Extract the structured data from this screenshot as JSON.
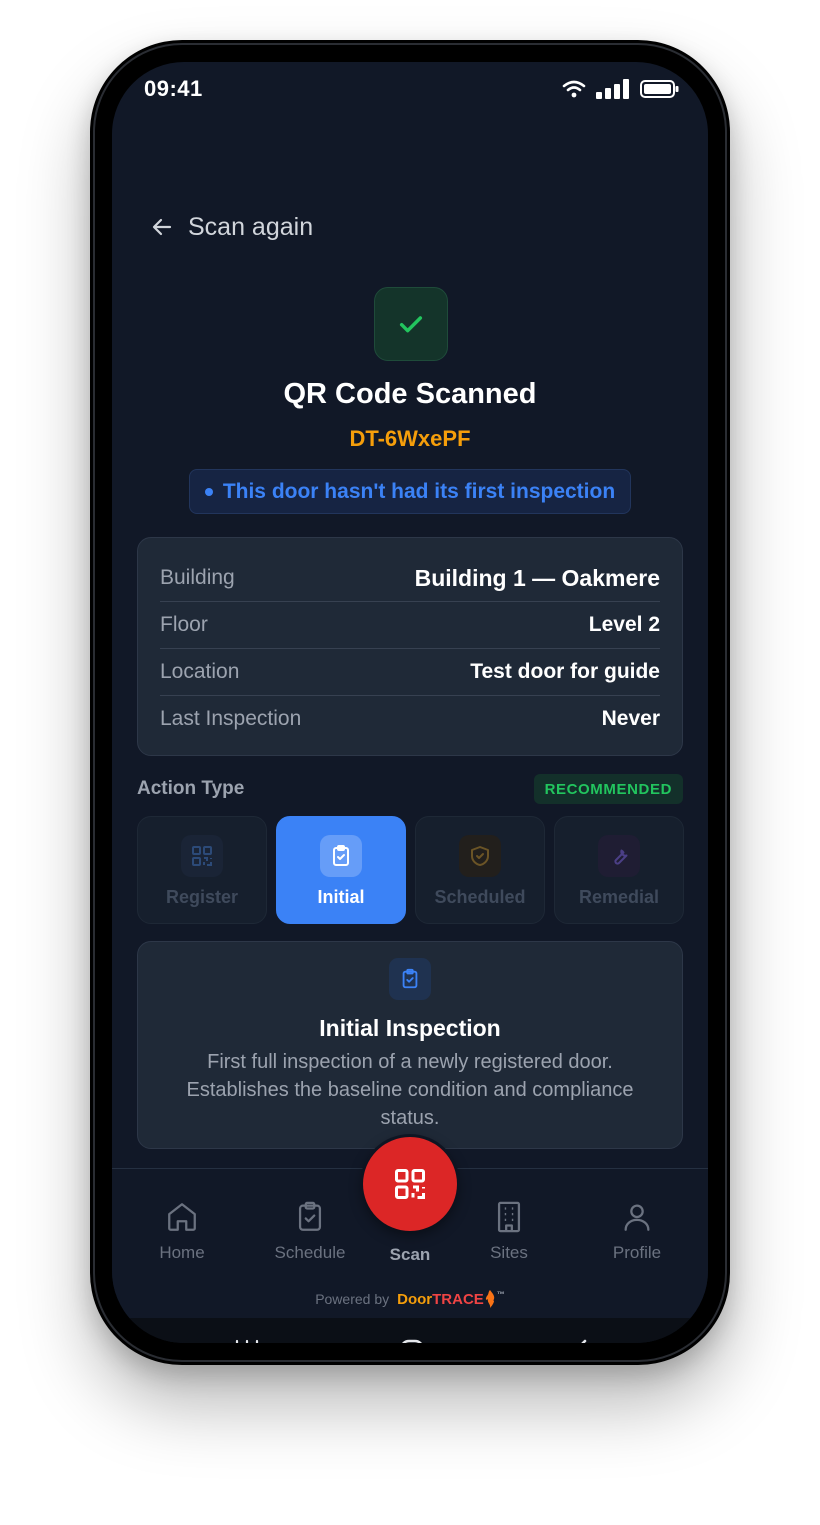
{
  "status_bar": {
    "time": "09:41",
    "icons": [
      "wifi-icon",
      "signal-icon",
      "battery-icon"
    ]
  },
  "header": {
    "back_label": "Scan again"
  },
  "scan_result": {
    "title": "QR Code Scanned",
    "door_id": "DT-6WxePF",
    "notice": "This door hasn't had its first inspection"
  },
  "door_info": {
    "rows": [
      {
        "label": "Building",
        "value": "Building 1 — Oakmere"
      },
      {
        "label": "Floor",
        "value": "Level 2"
      },
      {
        "label": "Location",
        "value": "Test door for guide"
      },
      {
        "label": "Last Inspection",
        "value": "Never"
      }
    ]
  },
  "action_type": {
    "label": "Action Type",
    "badge": "RECOMMENDED",
    "options": [
      {
        "label": "Register",
        "icon": "qr-code-icon",
        "selected": false
      },
      {
        "label": "Initial",
        "icon": "clipboard-check-icon",
        "selected": true
      },
      {
        "label": "Scheduled",
        "icon": "shield-check-icon",
        "selected": false
      },
      {
        "label": "Remedial",
        "icon": "wrench-icon",
        "selected": false
      }
    ]
  },
  "selected_action": {
    "title": "Initial Inspection",
    "description": "First full inspection of a newly registered door. Establishes the baseline condition and compliance status."
  },
  "bottom_nav": {
    "items": [
      {
        "label": "Home",
        "icon": "home-icon"
      },
      {
        "label": "Schedule",
        "icon": "clipboard-check-icon"
      },
      {
        "label": "Scan",
        "icon": "qr-code-icon"
      },
      {
        "label": "Sites",
        "icon": "building-icon"
      },
      {
        "label": "Profile",
        "icon": "user-icon"
      }
    ]
  },
  "footer": {
    "powered_by": "Powered by",
    "brand_part1": "Door",
    "brand_part2": "TRACE",
    "brand_tm": "™"
  },
  "colors": {
    "background": "#111827",
    "card": "#1f2937",
    "accent_blue": "#3b82f6",
    "accent_orange": "#f59e0b",
    "success_green": "#22c55e",
    "scan_red": "#dc2626"
  }
}
